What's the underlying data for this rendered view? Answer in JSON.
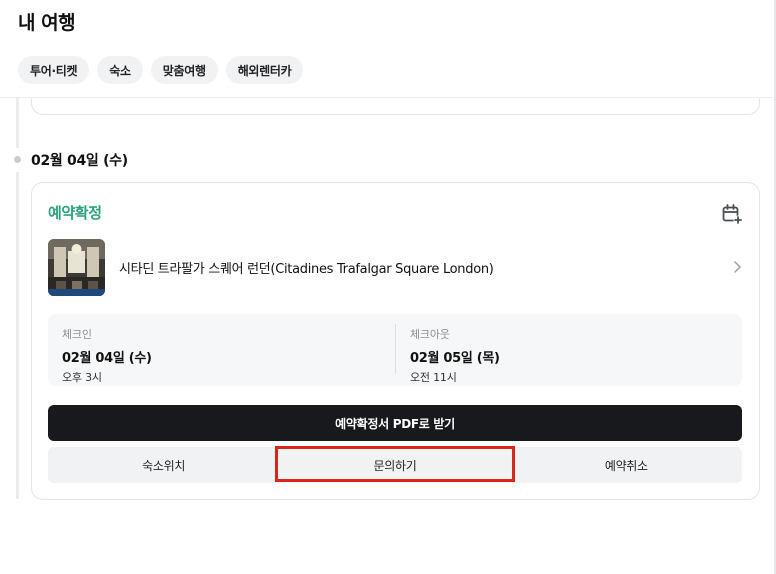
{
  "header": {
    "title": "내 여행",
    "chips": [
      {
        "label": "투어·티켓"
      },
      {
        "label": "숙소"
      },
      {
        "label": "맞춤여행"
      },
      {
        "label": "해외렌터카"
      }
    ]
  },
  "timeline": {
    "date_heading": "02월 04일 (수)"
  },
  "booking": {
    "status": "예약확정",
    "status_color": "#2ba37a",
    "calendar_icon": "calendar-plus-icon",
    "hotel_name": "시타딘 트라팔가 스퀘어 런던(Citadines Trafalgar Square London)",
    "check_in": {
      "label": "체크인",
      "date": "02월 04일 (수)",
      "time": "오후 3시"
    },
    "check_out": {
      "label": "체크아웃",
      "date": "02월 05일 (목)",
      "time": "오전 11시"
    },
    "pdf_button_label": "예약확정서 PDF로 받기",
    "actions": [
      {
        "label": "숙소위치"
      },
      {
        "label": "문의하기"
      },
      {
        "label": "예약취소"
      }
    ]
  },
  "highlight_color": "#d9261c"
}
